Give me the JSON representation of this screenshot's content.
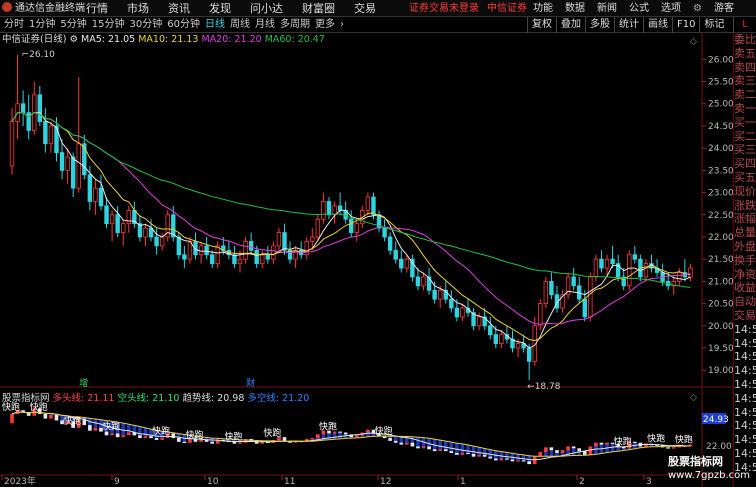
{
  "app": {
    "title": "通达信金融终端",
    "menu": [
      "行情",
      "市场",
      "资讯",
      "发现",
      "问小达",
      "财富圈",
      "交易"
    ],
    "alert": [
      "证券交易未登录",
      "中信证券"
    ],
    "tools": [
      "功能",
      "数据",
      "新闻",
      "公式",
      "选项"
    ],
    "guest": "游客"
  },
  "toolbar": {
    "periods": [
      "分时",
      "1分钟",
      "5分钟",
      "15分钟",
      "30分钟",
      "60分钟",
      "日线",
      "周线",
      "月线",
      "多周期",
      "更多"
    ],
    "active_period": "日线",
    "right": [
      "复权",
      "叠加",
      "多股",
      "统计",
      "画线",
      "F10",
      "标记"
    ]
  },
  "corner": "L",
  "main_info": {
    "title": "中信证券(日线)",
    "ma5": "MA5: 21.05",
    "ma10": "MA10: 21.13",
    "ma20": "MA20: 21.20",
    "ma60": "MA60: 20.47"
  },
  "indicator_info": {
    "name": "股票指标网",
    "duo": "多头线: 21.11",
    "kong": "空头线: 21.10",
    "trend": "趋势线: 20.98",
    "xiang": "多空线: 21.20",
    "value_tag": "24.93"
  },
  "right_panel": [
    "委比",
    "卖五",
    "卖四",
    "卖三",
    "卖二",
    "卖一",
    "买一",
    "买二",
    "买三",
    "买四",
    "买五",
    "现价",
    "涨跌",
    "涨幅",
    "总量",
    "外盘",
    "换手",
    "净资",
    "收益",
    "自动",
    "交易",
    "14:50",
    "14:50",
    "14:50",
    "14:50",
    "14:50",
    "14:50",
    "14:50",
    "14:50",
    "14:50",
    "14:50",
    "14:50"
  ],
  "watermark": {
    "line1": "股票指标网",
    "line2": "www.7gpzb.com"
  },
  "events": [
    "增",
    "财"
  ],
  "chart_data": {
    "type": "candlestick",
    "title": "中信证券(日线)",
    "x_tick_labels": [
      "2023年",
      "9",
      "10",
      "11",
      "12",
      "1",
      "2",
      "3"
    ],
    "y_ticks": [
      19.0,
      19.5,
      20.0,
      20.5,
      21.0,
      21.5,
      22.0,
      22.5,
      23.0,
      23.5,
      24.0,
      24.5,
      25.0,
      25.5,
      26.0
    ],
    "ylim": [
      18.78,
      26.3
    ],
    "annotations": {
      "high": "26.10",
      "low": "18.78"
    },
    "sub_y_ticks": [
      "24.93",
      "22.00"
    ],
    "sub_label": "快跑",
    "ohlc": [
      [
        23.6,
        24.9,
        23.4,
        24.6
      ],
      [
        24.6,
        26.1,
        24.2,
        25.0
      ],
      [
        25.0,
        25.3,
        24.5,
        24.8
      ],
      [
        24.8,
        25.2,
        24.2,
        24.4
      ],
      [
        24.4,
        25.5,
        24.3,
        25.2
      ],
      [
        25.2,
        25.4,
        24.5,
        24.6
      ],
      [
        24.6,
        24.9,
        23.9,
        24.1
      ],
      [
        24.1,
        24.6,
        23.9,
        24.5
      ],
      [
        24.5,
        24.7,
        23.7,
        23.9
      ],
      [
        23.9,
        24.2,
        23.3,
        23.5
      ],
      [
        23.5,
        24.0,
        23.2,
        23.8
      ],
      [
        23.8,
        23.9,
        22.9,
        23.1
      ],
      [
        23.1,
        25.6,
        23.0,
        24.1
      ],
      [
        24.1,
        24.3,
        23.3,
        23.4
      ],
      [
        23.4,
        23.6,
        22.6,
        22.8
      ],
      [
        22.8,
        23.3,
        22.5,
        23.1
      ],
      [
        23.1,
        23.4,
        22.6,
        22.7
      ],
      [
        22.7,
        22.9,
        22.2,
        22.3
      ],
      [
        22.3,
        22.6,
        21.9,
        22.5
      ],
      [
        22.5,
        22.7,
        22.0,
        22.1
      ],
      [
        22.1,
        22.4,
        21.8,
        22.3
      ],
      [
        22.3,
        22.7,
        22.1,
        22.6
      ],
      [
        22.6,
        22.8,
        22.2,
        22.3
      ],
      [
        22.3,
        22.5,
        21.9,
        22.0
      ],
      [
        22.0,
        22.3,
        21.8,
        22.2
      ],
      [
        22.2,
        22.4,
        21.9,
        22.0
      ],
      [
        22.0,
        22.2,
        21.6,
        21.8
      ],
      [
        21.8,
        22.1,
        21.7,
        22.0
      ],
      [
        22.0,
        22.6,
        21.9,
        22.5
      ],
      [
        22.5,
        22.7,
        21.9,
        22.0
      ],
      [
        22.0,
        22.1,
        21.5,
        21.6
      ],
      [
        21.6,
        21.8,
        21.3,
        21.5
      ],
      [
        21.5,
        22.0,
        21.4,
        21.9
      ],
      [
        21.9,
        22.1,
        21.5,
        21.6
      ],
      [
        21.6,
        21.9,
        21.4,
        21.8
      ],
      [
        21.8,
        22.0,
        21.5,
        21.6
      ],
      [
        21.6,
        21.7,
        21.3,
        21.4
      ],
      [
        21.4,
        21.9,
        21.3,
        21.8
      ],
      [
        21.8,
        22.0,
        21.6,
        21.7
      ],
      [
        21.7,
        21.9,
        21.5,
        21.6
      ],
      [
        21.6,
        21.8,
        21.3,
        21.4
      ],
      [
        21.4,
        21.7,
        21.2,
        21.5
      ],
      [
        21.5,
        22.0,
        21.4,
        21.9
      ],
      [
        21.9,
        22.1,
        21.6,
        21.7
      ],
      [
        21.7,
        21.8,
        21.3,
        21.4
      ],
      [
        21.4,
        21.7,
        21.3,
        21.6
      ],
      [
        21.6,
        21.8,
        21.4,
        21.5
      ],
      [
        21.5,
        21.9,
        21.4,
        21.8
      ],
      [
        21.8,
        22.2,
        21.7,
        22.1
      ],
      [
        22.1,
        22.3,
        21.6,
        21.7
      ],
      [
        21.7,
        21.9,
        21.4,
        21.5
      ],
      [
        21.5,
        21.8,
        21.3,
        21.7
      ],
      [
        21.7,
        21.9,
        21.5,
        21.6
      ],
      [
        21.6,
        22.0,
        21.5,
        21.9
      ],
      [
        21.9,
        22.2,
        21.7,
        22.0
      ],
      [
        22.0,
        22.5,
        21.9,
        22.4
      ],
      [
        22.4,
        23.0,
        22.3,
        22.8
      ],
      [
        22.8,
        22.9,
        22.4,
        22.5
      ],
      [
        22.5,
        22.8,
        22.3,
        22.7
      ],
      [
        22.7,
        23.0,
        22.5,
        22.6
      ],
      [
        22.6,
        22.8,
        22.3,
        22.4
      ],
      [
        22.4,
        22.6,
        22.0,
        22.1
      ],
      [
        22.1,
        22.4,
        21.9,
        22.3
      ],
      [
        22.3,
        22.7,
        22.2,
        22.6
      ],
      [
        22.6,
        23.0,
        22.5,
        22.9
      ],
      [
        22.9,
        23.0,
        22.4,
        22.5
      ],
      [
        22.5,
        22.6,
        22.1,
        22.2
      ],
      [
        22.2,
        22.4,
        21.9,
        22.0
      ],
      [
        22.0,
        22.1,
        21.6,
        21.7
      ],
      [
        21.7,
        21.9,
        21.4,
        21.5
      ],
      [
        21.5,
        21.7,
        21.2,
        21.3
      ],
      [
        21.3,
        21.6,
        21.2,
        21.5
      ],
      [
        21.5,
        21.6,
        21.0,
        21.1
      ],
      [
        21.1,
        21.3,
        20.8,
        20.9
      ],
      [
        20.9,
        21.2,
        20.8,
        21.1
      ],
      [
        21.1,
        21.3,
        20.7,
        20.8
      ],
      [
        20.8,
        21.0,
        20.5,
        20.6
      ],
      [
        20.6,
        20.9,
        20.4,
        20.8
      ],
      [
        20.8,
        21.0,
        20.5,
        20.6
      ],
      [
        20.6,
        20.8,
        20.3,
        20.4
      ],
      [
        20.4,
        20.6,
        20.1,
        20.2
      ],
      [
        20.2,
        20.5,
        20.1,
        20.4
      ],
      [
        20.4,
        20.6,
        20.2,
        20.3
      ],
      [
        20.3,
        20.4,
        19.9,
        20.0
      ],
      [
        20.0,
        20.3,
        19.9,
        20.2
      ],
      [
        20.2,
        20.4,
        19.9,
        20.0
      ],
      [
        20.0,
        20.2,
        19.7,
        19.8
      ],
      [
        19.8,
        20.0,
        19.5,
        19.6
      ],
      [
        19.6,
        19.9,
        19.5,
        19.8
      ],
      [
        19.8,
        20.0,
        19.6,
        19.7
      ],
      [
        19.7,
        19.9,
        19.4,
        19.5
      ],
      [
        19.5,
        19.7,
        19.3,
        19.6
      ],
      [
        19.6,
        19.8,
        19.4,
        19.5
      ],
      [
        19.5,
        19.6,
        18.78,
        19.2
      ],
      [
        19.2,
        20.2,
        19.1,
        20.0
      ],
      [
        20.0,
        20.6,
        19.9,
        20.5
      ],
      [
        20.5,
        21.1,
        20.4,
        21.0
      ],
      [
        21.0,
        21.2,
        20.6,
        20.7
      ],
      [
        20.7,
        20.9,
        20.3,
        20.4
      ],
      [
        20.4,
        20.8,
        20.3,
        20.7
      ],
      [
        20.7,
        21.2,
        20.6,
        21.1
      ],
      [
        21.1,
        21.3,
        20.8,
        20.9
      ],
      [
        20.9,
        21.1,
        20.5,
        20.6
      ],
      [
        20.6,
        20.8,
        20.1,
        20.2
      ],
      [
        20.2,
        21.2,
        20.1,
        21.1
      ],
      [
        21.1,
        21.6,
        21.0,
        21.5
      ],
      [
        21.5,
        21.7,
        21.2,
        21.3
      ],
      [
        21.3,
        21.6,
        21.1,
        21.5
      ],
      [
        21.5,
        21.8,
        21.3,
        21.4
      ],
      [
        21.4,
        21.6,
        21.0,
        21.1
      ],
      [
        21.1,
        21.3,
        20.8,
        20.9
      ],
      [
        20.9,
        21.7,
        20.8,
        21.6
      ],
      [
        21.6,
        21.8,
        21.4,
        21.5
      ],
      [
        21.5,
        21.6,
        21.0,
        21.1
      ],
      [
        21.1,
        21.5,
        21.0,
        21.4
      ],
      [
        21.4,
        21.6,
        21.2,
        21.3
      ],
      [
        21.3,
        21.5,
        21.1,
        21.2
      ],
      [
        21.2,
        21.4,
        20.9,
        21.0
      ],
      [
        21.0,
        21.2,
        20.8,
        20.9
      ],
      [
        20.9,
        21.1,
        20.7,
        21.0
      ],
      [
        21.0,
        21.3,
        20.9,
        21.2
      ],
      [
        21.2,
        21.5,
        21.0,
        21.1
      ],
      [
        21.1,
        21.4,
        21.0,
        21.3
      ]
    ],
    "ma_colors": {
      "MA5": "#e8e8e8",
      "MA10": "#f0d030",
      "MA20": "#e040e0",
      "MA60": "#20c040"
    },
    "up_color": "#ff3838",
    "down_color": "#2fd4e0"
  }
}
